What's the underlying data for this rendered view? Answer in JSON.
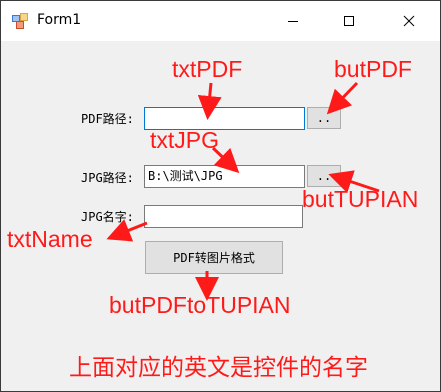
{
  "window": {
    "title": "Form1"
  },
  "form": {
    "pdf_label": "PDF路径:",
    "pdf_value": "",
    "pdf_browse": "..",
    "jpg_label": "JPG路径:",
    "jpg_value": "B:\\测试\\JPG",
    "jpg_browse": "..",
    "name_label": "JPG名字:",
    "name_value": "",
    "convert_button": "PDF转图片格式"
  },
  "annotations": {
    "txtPDF": "txtPDF",
    "butPDF": "butPDF",
    "txtJPG": "txtJPG",
    "butTUPIAN": "butTUPIAN",
    "txtName": "txtName",
    "butPDFtoTUPIAN": "butPDFtoTUPIAN",
    "note": "上面对应的英文是控件的名字"
  },
  "colors": {
    "annotation": "#ff1a1a",
    "focus_border": "#0078d7"
  }
}
